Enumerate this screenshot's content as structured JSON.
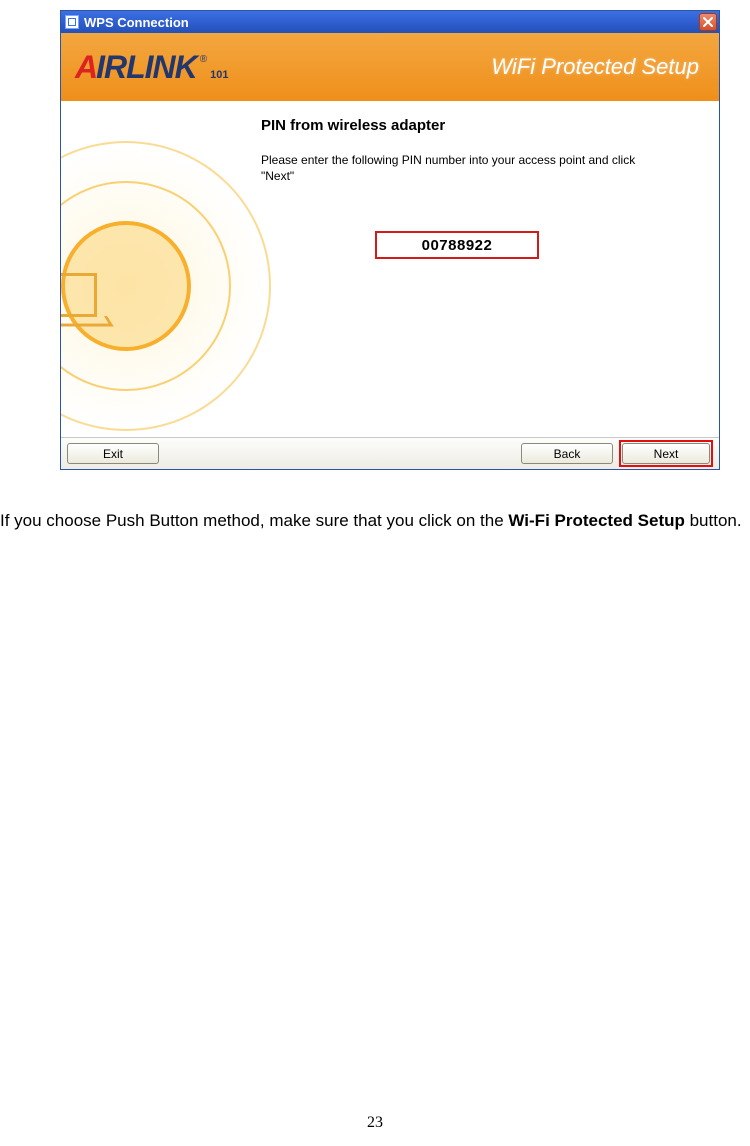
{
  "dialog": {
    "title": "WPS Connection",
    "banner": {
      "brand_a": "A",
      "brand_rest": "IRLINK",
      "brand_sub": "101",
      "brand_reg": "®",
      "heading": "WiFi Protected Setup"
    },
    "body": {
      "heading": "PIN from wireless adapter",
      "paragraph": "Please enter the following PIN number into your access point and click \"Next\"",
      "pin": "00788922"
    },
    "buttons": {
      "exit": "Exit",
      "back": "Back",
      "next": "Next"
    }
  },
  "doc": {
    "paragraph_pre": "If you choose Push Button method, make sure that you click on the ",
    "paragraph_bold": "Wi-Fi Protected Setup",
    "paragraph_post": " button.",
    "page_number": "23"
  }
}
